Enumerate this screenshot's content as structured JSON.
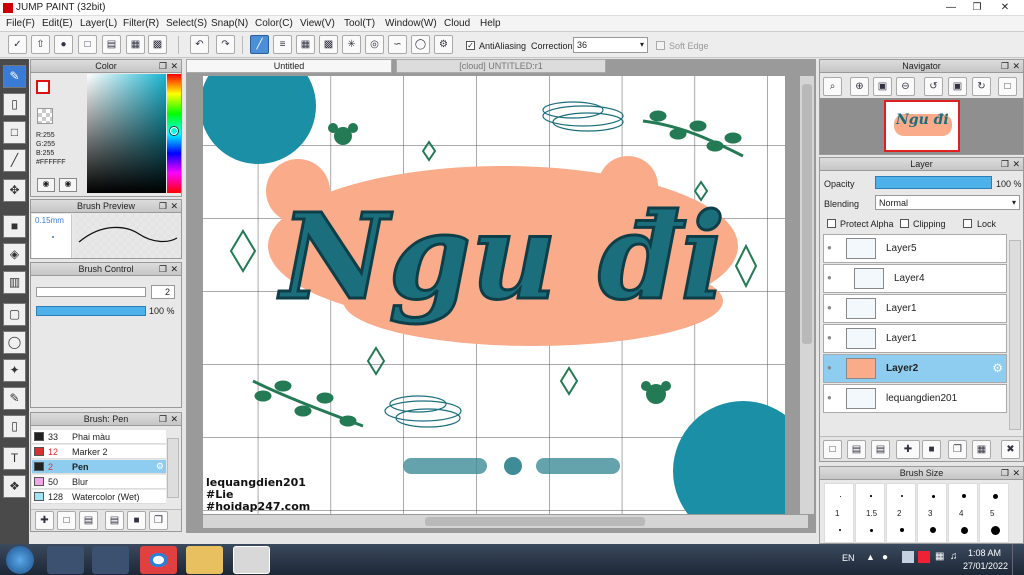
{
  "app": {
    "title": "JUMP PAINT (32bit)"
  },
  "menu": [
    "File(F)",
    "Edit(E)",
    "Layer(L)",
    "Filter(R)",
    "Select(S)",
    "Snap(N)",
    "Color(C)",
    "View(V)",
    "Tool(T)",
    "Window(W)",
    "Cloud",
    "Help"
  ],
  "toolbar": {
    "antialias_label": "AntiAliasing",
    "correction_label": "Correction",
    "correction_value": "36",
    "softedge_label": "Soft Edge"
  },
  "color": {
    "title": "Color",
    "r": "R:255",
    "g": "G:255",
    "b": "B:255",
    "hex": "#FFFFFF",
    "accent": "#3a7bd5"
  },
  "brush_preview": {
    "title": "Brush Preview",
    "size": "0.15mm"
  },
  "brush_control": {
    "title": "Brush Control",
    "size_value": "2",
    "opacity_value": "100 %"
  },
  "brush_list": {
    "title": "Brush: Pen",
    "items": [
      {
        "size": "33",
        "name": "Phai màu",
        "color": "#222222"
      },
      {
        "size": "12",
        "name": "Marker 2",
        "color": "#d83030"
      },
      {
        "size": "2",
        "name": "Pen",
        "color": "#222222"
      },
      {
        "size": "50",
        "name": "Blur",
        "color": "#f2a6e8"
      },
      {
        "size": "128",
        "name": "Watercolor (Wet)",
        "color": "#9fe3f5"
      }
    ]
  },
  "tabs": {
    "tab1": "Untitled",
    "tab2": "[cloud] UNTITLED:r1"
  },
  "artwork": {
    "title": "Ngu đi",
    "credit1": "lequangdien201",
    "credit2": "#Lie",
    "credit3": "#hoidap247.com",
    "peach": "#f9ab8a",
    "teal": "#1b6e7c",
    "green": "#237a54"
  },
  "navigator": {
    "title": "Navigator"
  },
  "layer_panel": {
    "title": "Layer",
    "opacity_label": "Opacity",
    "opacity_value": "100 %",
    "blending_label": "Blending",
    "blending_value": "Normal",
    "protect_alpha": "Protect Alpha",
    "clipping": "Clipping",
    "lock": "Lock",
    "layers": [
      "Layer5",
      "Layer4",
      "Layer1",
      "Layer1",
      "Layer2",
      "lequangdien201"
    ]
  },
  "brush_size": {
    "title": "Brush Size",
    "labels": [
      "1",
      "1.5",
      "2",
      "3",
      "4",
      "5"
    ]
  },
  "taskbar": {
    "lang": "EN",
    "time": "1:08 AM",
    "date": "27/01/2022"
  }
}
